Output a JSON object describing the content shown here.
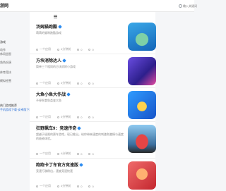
{
  "header": {
    "brand": "游网",
    "search_placeholder": "输入关键词查找游戏"
  },
  "sidebar": {
    "categories": [
      "游戏",
      "动作",
      "休闲益智",
      "角色扮演",
      "体育竞技",
      "模拟经营"
    ],
    "strong_text": "热门游戏推荐",
    "link_text": "手机游戏下载·安卓版下载"
  },
  "feed": {
    "cards": [
      {
        "title": "汤姆猫跑酷",
        "desc": "萌萌的猫咪跑酷游戏",
        "meta": [
          "一个应用",
          "4分钟前",
          "0",
          "0"
        ],
        "thumb_class": "t-cat",
        "thumb_icon": "tom-cat-icon"
      },
      {
        "title": "方块消除达人",
        "desc": "简单三个相同的方块消除小游戏",
        "meta": [
          "一个应用",
          "4分钟前",
          "0",
          "0"
        ],
        "thumb_class": "t-piano",
        "thumb_icon": "piano-tiles-icon"
      },
      {
        "title": "大鱼小鱼大作战",
        "desc": "不停吞食鱼类变大鱼",
        "meta": [
          "一个应用",
          "4分钟前",
          "0",
          "0"
        ],
        "thumb_class": "t-fish",
        "thumb_icon": "fish-icon"
      },
      {
        "title": "狂野飙车9：竞速传奇",
        "desc": "超越于极限的赛车游戏，现已推出。给你带来速度的刺激和激情与速度的极致体验。",
        "meta": [
          "一个应用",
          "4分钟前",
          "0",
          "0"
        ],
        "thumb_class": "t-car",
        "thumb_icon": "racing-car-icon"
      },
      {
        "title": "跑跑卡丁车官方竞速版",
        "desc": "竞速行驶刷出，速度竞速快速",
        "meta": [
          "一个应用",
          "4分钟前",
          "0",
          "0"
        ],
        "thumb_class": "t-run",
        "thumb_icon": "kart-racer-icon"
      }
    ]
  }
}
